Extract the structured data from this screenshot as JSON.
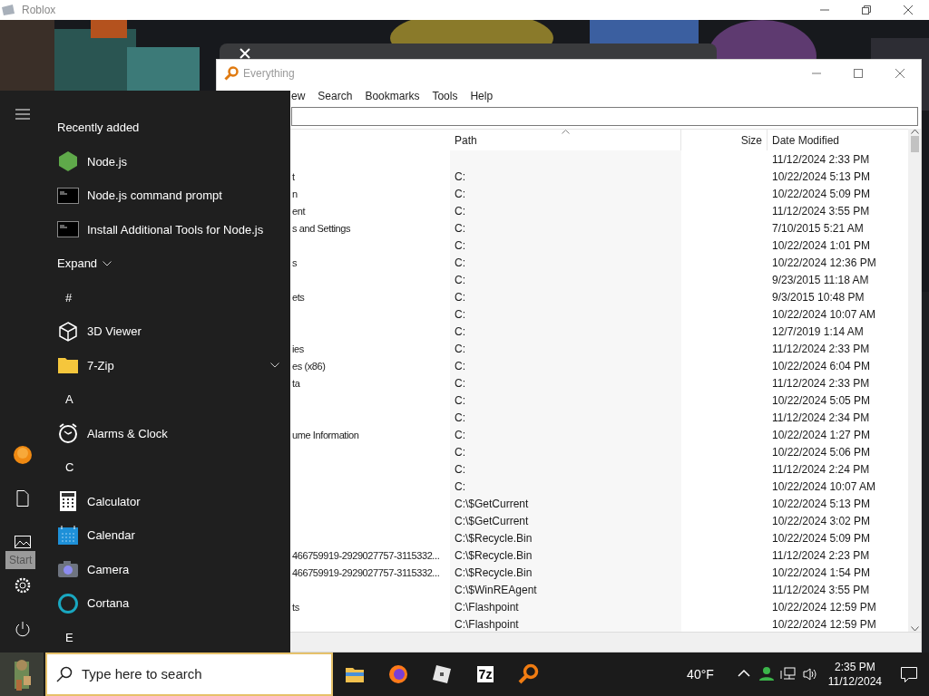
{
  "roblox_window": {
    "title": "Roblox"
  },
  "everything_window": {
    "title": "Everything",
    "menu": [
      "ew",
      "Search",
      "Bookmarks",
      "Tools",
      "Help"
    ],
    "columns": [
      {
        "label": "Path",
        "sorted": true
      },
      {
        "label": "Size",
        "sorted": false
      },
      {
        "label": "Date Modified",
        "sorted": false
      }
    ],
    "rows": [
      {
        "date": "11/12/2024 2:33 PM"
      },
      {
        "name": "t",
        "path": "C:",
        "date": "10/22/2024 5:13 PM"
      },
      {
        "name": "n",
        "path": "C:",
        "date": "10/22/2024 5:09 PM"
      },
      {
        "name": "ent",
        "path": "C:",
        "date": "11/12/2024 3:55 PM"
      },
      {
        "name": "s and Settings",
        "path": "C:",
        "date": "7/10/2015 5:21 AM"
      },
      {
        "path": "C:",
        "date": "10/22/2024 1:01 PM"
      },
      {
        "name": "s",
        "path": "C:",
        "date": "10/22/2024 12:36 PM"
      },
      {
        "path": "C:",
        "date": "9/23/2015 11:18 AM"
      },
      {
        "name": "ets",
        "path": "C:",
        "date": "9/3/2015 10:48 PM"
      },
      {
        "path": "C:",
        "date": "10/22/2024 10:07 AM"
      },
      {
        "path": "C:",
        "date": "12/7/2019 1:14 AM"
      },
      {
        "name": "ies",
        "path": "C:",
        "date": "11/12/2024 2:33 PM"
      },
      {
        "name": "es (x86)",
        "path": "C:",
        "date": "10/22/2024 6:04 PM"
      },
      {
        "name": "ta",
        "path": "C:",
        "date": "11/12/2024 2:33 PM"
      },
      {
        "path": "C:",
        "date": "10/22/2024 5:05 PM"
      },
      {
        "path": "C:",
        "date": "11/12/2024 2:34 PM"
      },
      {
        "name": "ume Information",
        "path": "C:",
        "date": "10/22/2024 1:27 PM"
      },
      {
        "path": "C:",
        "date": "10/22/2024 5:06 PM"
      },
      {
        "path": "C:",
        "date": "11/12/2024 2:24 PM"
      },
      {
        "path": "C:",
        "date": "10/22/2024 10:07 AM"
      },
      {
        "path": "C:\\$GetCurrent",
        "date": "10/22/2024 5:13 PM"
      },
      {
        "path": "C:\\$GetCurrent",
        "date": "10/22/2024 3:02 PM"
      },
      {
        "path": "C:\\$Recycle.Bin",
        "date": "10/22/2024 5:09 PM"
      },
      {
        "name": "466759919-2929027757-3115332...",
        "path": "C:\\$Recycle.Bin",
        "date": "11/12/2024 2:23 PM"
      },
      {
        "name": "466759919-2929027757-3115332...",
        "path": "C:\\$Recycle.Bin",
        "date": "10/22/2024 1:54 PM"
      },
      {
        "path": "C:\\$WinREAgent",
        "date": "11/12/2024 3:55 PM"
      },
      {
        "name": "ts",
        "path": "C:\\Flashpoint",
        "date": "10/22/2024 12:59 PM"
      },
      {
        "path": "C:\\Flashpoint",
        "date": "10/22/2024 12:59 PM"
      }
    ]
  },
  "start_menu": {
    "tooltip": "Start",
    "recent": {
      "heading": "Recently added",
      "items": [
        {
          "label": "Node.js",
          "kind": "node"
        },
        {
          "label": "Node.js command prompt",
          "kind": "console"
        },
        {
          "label": "Install Additional Tools for Node.js",
          "kind": "console"
        }
      ],
      "expand": "Expand"
    },
    "groups": [
      {
        "letter": "#",
        "items": [
          {
            "label": "3D Viewer",
            "kind": "cube"
          },
          {
            "label": "7-Zip",
            "kind": "folder",
            "expanded": false
          }
        ]
      },
      {
        "letter": "A",
        "items": [
          {
            "label": "Alarms & Clock",
            "kind": "clock"
          }
        ]
      },
      {
        "letter": "C",
        "items": [
          {
            "label": "Calculator",
            "kind": "calculator"
          },
          {
            "label": "Calendar",
            "kind": "calendar"
          },
          {
            "label": "Camera",
            "kind": "camera"
          },
          {
            "label": "Cortana",
            "kind": "cortana"
          }
        ]
      },
      {
        "letter": "E"
      }
    ]
  },
  "taskbar": {
    "search": {
      "placeholder": "Type here to search"
    },
    "apps": [
      {
        "kind": "explorer"
      },
      {
        "kind": "firefox"
      },
      {
        "kind": "roblox"
      },
      {
        "kind": "sevenzip",
        "label": "7z"
      },
      {
        "kind": "everything"
      }
    ],
    "weather": "40°F",
    "time": "2:35 PM",
    "date": "11/12/2024"
  }
}
